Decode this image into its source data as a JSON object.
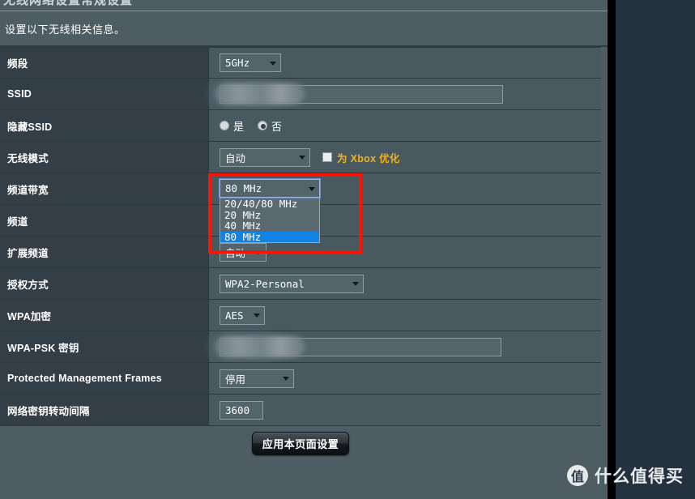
{
  "window": {
    "background_color": "#243240",
    "page_background": "#4e5d64",
    "truncated_tab_left": "无线网络设置",
    "truncated_tab_right": "常规设置"
  },
  "description": "设置以下无线相关信息。",
  "table": {
    "rows": [
      {
        "label": "频段",
        "control": "select",
        "value": "5GHz"
      },
      {
        "label": "SSID",
        "control": "text",
        "value": "",
        "redacted": true
      },
      {
        "label": "隐藏SSID",
        "control": "radio",
        "options": [
          "是",
          "否"
        ],
        "selected": "否"
      },
      {
        "label": "无线模式",
        "control": "select",
        "value": "自动",
        "checkbox_label": "为 Xbox 优化",
        "checkbox_checked": false
      },
      {
        "label": "频道带宽",
        "control": "select-open",
        "value": "80 MHz"
      },
      {
        "label": "频道",
        "control": "select",
        "value": ""
      },
      {
        "label": "扩展频道",
        "control": "select",
        "value": "自动"
      },
      {
        "label": "授权方式",
        "control": "select",
        "value": "WPA2-Personal"
      },
      {
        "label": "WPA加密",
        "control": "select",
        "value": "AES"
      },
      {
        "label": "WPA-PSK 密钥",
        "control": "text",
        "value": "",
        "redacted": true
      },
      {
        "label": "Protected Management Frames",
        "control": "select",
        "value": "停用"
      },
      {
        "label": "网络密钥转动间隔",
        "control": "text",
        "value": "3600"
      }
    ]
  },
  "bandwidth_dropdown": {
    "current": "80 MHz",
    "options": [
      "20/40/80 MHz",
      "20 MHz",
      "40 MHz",
      "80 MHz"
    ],
    "selected_index": 3,
    "highlight_color": "#1283e2",
    "annotation_color": "#fa1405"
  },
  "apply_button": {
    "label": "应用本页面设置"
  },
  "watermark": {
    "logo": "值",
    "text": "什么值得买"
  }
}
